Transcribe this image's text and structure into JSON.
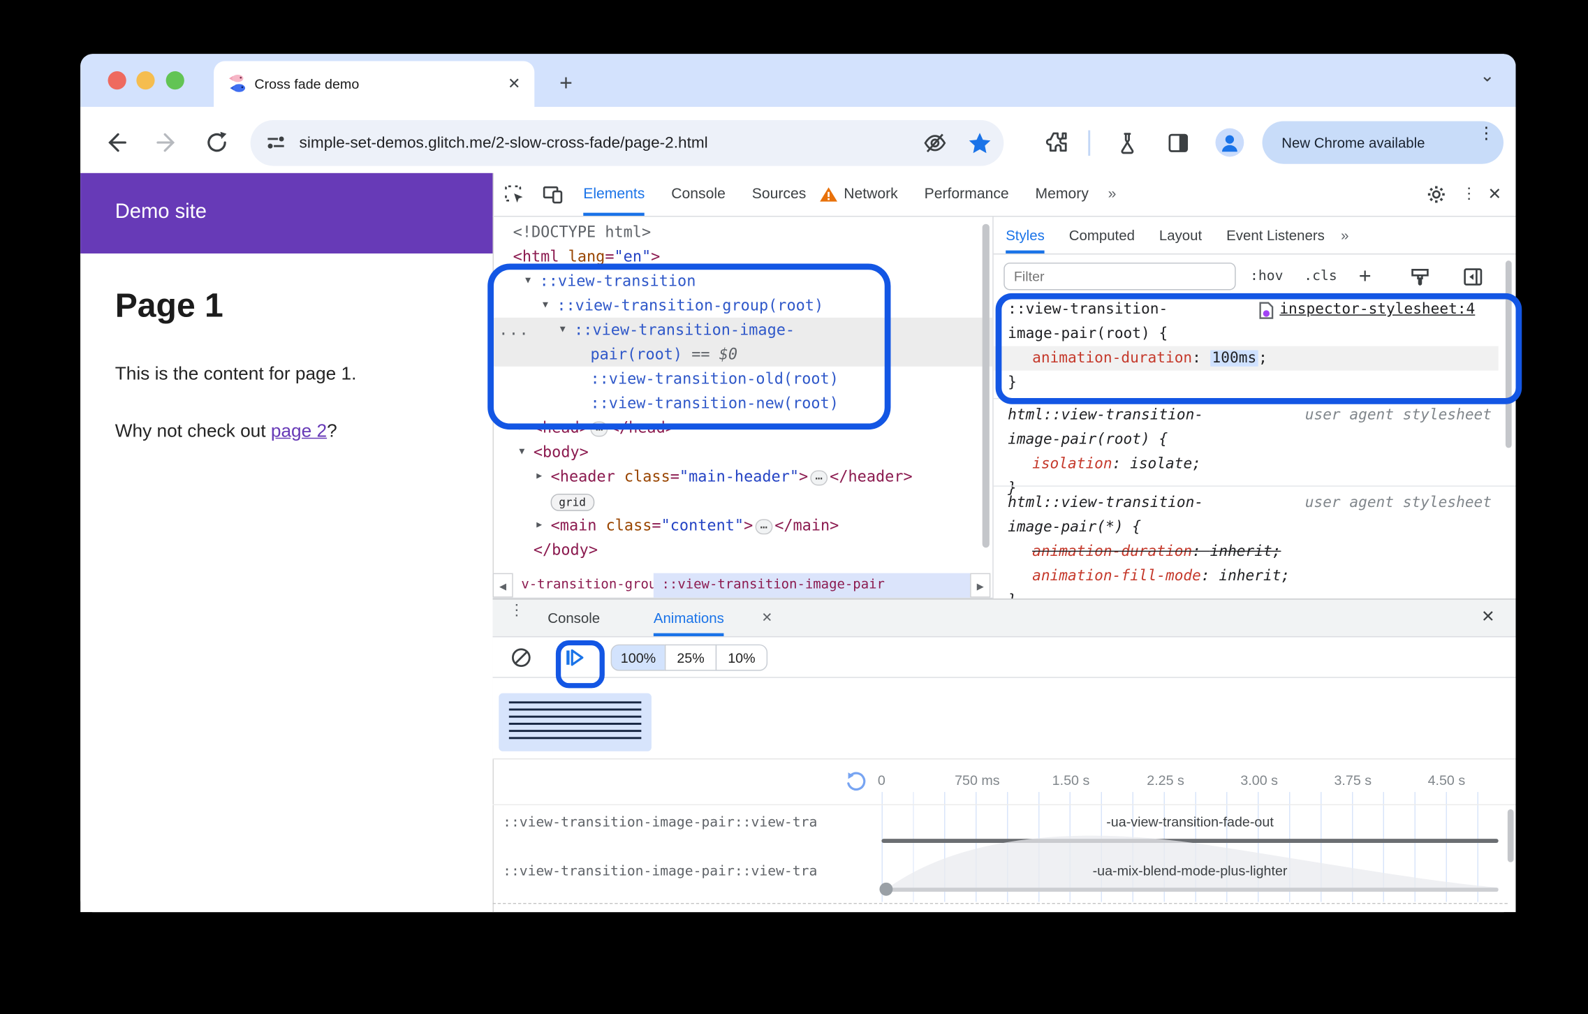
{
  "browser": {
    "tab_title": "Cross fade demo",
    "url": "simple-set-demos.glitch.me/2-slow-cross-fade/page-2.html",
    "update_button": "New Chrome available"
  },
  "page": {
    "site_header": "Demo site",
    "title": "Page 1",
    "paragraph": "This is the content for page 1.",
    "cta_before": "Why not check out ",
    "cta_link": "page 2",
    "cta_after": "?"
  },
  "devtools": {
    "main_tabs": [
      "Elements",
      "Console",
      "Sources",
      "Network",
      "Performance",
      "Memory"
    ],
    "more_tabs_symbol": "»",
    "dom": {
      "doctype": "<!DOCTYPE html>",
      "html_open": "<html",
      "html_attr": " lang",
      "html_eq": "=",
      "html_value": "\"en\"",
      "html_gt": ">",
      "vt": "::view-transition",
      "vtg": "::view-transition-group(root)",
      "vtip_line1": "::view-transition-image-",
      "vtip_line2": "pair(root)",
      "selected_suffix": "== $0",
      "vto": "::view-transition-old(root)",
      "vtn": "::view-transition-new(root)",
      "head_open": "<head>",
      "head_close": "</head>",
      "body_open": "<body>",
      "header_open": "<header",
      "class_attr": " class",
      "eq": "=",
      "header_class": "\"main-header\"",
      "gt": ">",
      "header_close": "</header>",
      "grid_badge": "grid",
      "main_open": "<main",
      "main_class": "\"content\"",
      "main_close": "</main>",
      "body_close": "</body>"
    },
    "breadcrumbs": {
      "prev": "v-transition-group",
      "current": "::view-transition-image-pair"
    },
    "sidebar_tabs": [
      "Styles",
      "Computed",
      "Layout",
      "Event Listeners"
    ],
    "styles": {
      "filter_placeholder": "Filter",
      "hov": ":hov",
      "cls": ".cls",
      "rules": [
        {
          "selector_line1": "::view-transition-",
          "selector_line2": "image-pair(root) {",
          "source": "inspector-stylesheet:4",
          "property": "animation-duration",
          "value": "100ms",
          "close": "}"
        },
        {
          "selector_line1": "html::view-transition-",
          "selector_line2": "image-pair(root) {",
          "source": "user agent stylesheet",
          "property": "isolation",
          "value": "isolate;",
          "close": "}"
        },
        {
          "selector_line1": "html::view-transition-",
          "selector_line2": "image-pair(*) {",
          "source": "user agent stylesheet",
          "property": "animation-duration",
          "value": "inherit;",
          "property2": "animation-fill-mode",
          "value2": "inherit;",
          "close": "}"
        }
      ]
    },
    "drawer": {
      "tabs": [
        "Console",
        "Animations"
      ],
      "speeds": [
        "100%",
        "25%",
        "10%"
      ],
      "selected_speed": "100%",
      "timeline_ticks": [
        "0",
        "750 ms",
        "1.50 s",
        "2.25 s",
        "3.00 s",
        "3.75 s",
        "4.50 s"
      ],
      "rows": [
        {
          "selector": "::view-transition-image-pair::view-tra",
          "animation": "-ua-view-transition-fade-out"
        },
        {
          "selector": "::view-transition-image-pair::view-tra",
          "animation": "-ua-mix-blend-mode-plus-lighter"
        }
      ]
    }
  },
  "colors": {
    "accent_blue": "#1a73e8",
    "annotation_blue": "#1356e4",
    "brand_purple": "#673ab7",
    "tabstrip_bg": "#d3e2fd",
    "dom_tag": "#8b1a4f",
    "dom_attr_name": "#994500",
    "dom_attr_value": "#2443c4",
    "dom_pseudo": "#2f58c9",
    "css_property": "#c5392b",
    "warning_orange": "#e8710a",
    "value_selection_bg": "#cfe1ff"
  }
}
